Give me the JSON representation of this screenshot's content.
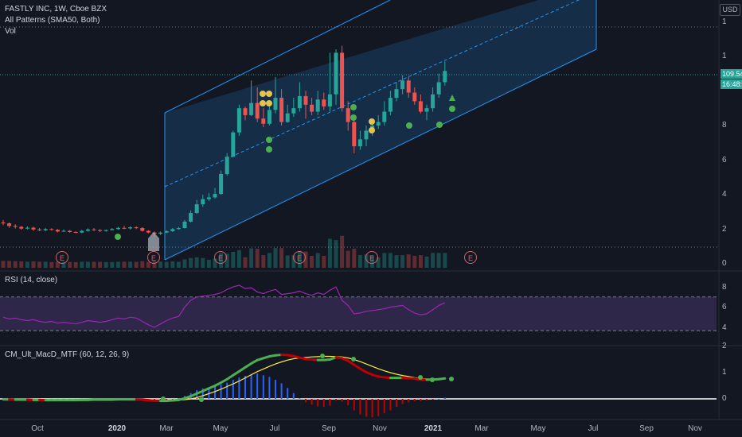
{
  "header": {
    "title": "FASTLY INC, 1W, Cboe BZX",
    "indicator_patterns": "All Patterns (SMA50, Both)",
    "indicator_vol": "Vol"
  },
  "currency": "USD",
  "price_labels": [
    "1",
    "1",
    "8",
    "6",
    "4",
    "2",
    "0"
  ],
  "last_price_tag": "109.54",
  "countdown_tag": "16:48:",
  "rsi": {
    "title": "RSI (14, close)",
    "levels": [
      "8",
      "6",
      "4"
    ]
  },
  "macd": {
    "title": "CM_Ult_MacD_MTF (60, 12, 26, 9)",
    "levels": [
      "2",
      "1",
      "0"
    ]
  },
  "x_ticks": [
    {
      "label": "Oct",
      "bold": false
    },
    {
      "label": "2020",
      "bold": true
    },
    {
      "label": "Mar",
      "bold": false
    },
    {
      "label": "May",
      "bold": false
    },
    {
      "label": "Jul",
      "bold": false
    },
    {
      "label": "Sep",
      "bold": false
    },
    {
      "label": "Nov",
      "bold": false
    },
    {
      "label": "2021",
      "bold": true
    },
    {
      "label": "Mar",
      "bold": false
    },
    {
      "label": "May",
      "bold": false
    },
    {
      "label": "Jul",
      "bold": false
    },
    {
      "label": "Sep",
      "bold": false
    },
    {
      "label": "Nov",
      "bold": false
    }
  ],
  "earnings_marker": "E",
  "colors": {
    "background": "#131722",
    "up": "#26a69a",
    "down": "#ef5350",
    "channel": "#2196f3",
    "rsi_line": "#9c27b0",
    "macd_up": "#4caf50",
    "macd_down": "#c00000",
    "signal": "#ffeb3b",
    "pattern_yellow": "#e5c350",
    "pattern_green": "#4caf50"
  },
  "chart_data": {
    "type": "candlestick",
    "title": "FASTLY INC, 1W, Cboe BZX",
    "series_price": [
      [
        22,
        21.5,
        23.5,
        20.5
      ],
      [
        21.5,
        20,
        22,
        19
      ],
      [
        20,
        19.5,
        21,
        18.5
      ],
      [
        19.5,
        18.5,
        20,
        17.8
      ],
      [
        18.5,
        19,
        19.8,
        18
      ],
      [
        19,
        18,
        19.5,
        17.2
      ],
      [
        18,
        17.5,
        18.8,
        17
      ],
      [
        17.5,
        18.2,
        18.8,
        17
      ],
      [
        18.2,
        17.8,
        18.7,
        17.3
      ],
      [
        17.8,
        16.8,
        18.2,
        16.3
      ],
      [
        16.8,
        17.2,
        18,
        16.5
      ],
      [
        17.2,
        16.5,
        17.6,
        16.1
      ],
      [
        16.5,
        16.2,
        17,
        15.8
      ],
      [
        16.2,
        17.2,
        17.8,
        15.9
      ],
      [
        17.2,
        18,
        18.6,
        16.8
      ],
      [
        18,
        17.6,
        18.8,
        17.1
      ],
      [
        17.6,
        17.1,
        18.2,
        16.5
      ],
      [
        17.1,
        17.6,
        18,
        16.7
      ],
      [
        17.6,
        18.2,
        18.8,
        17.4
      ],
      [
        18.2,
        18.9,
        19.5,
        17.8
      ],
      [
        18.9,
        18.6,
        20,
        18.2
      ],
      [
        18.6,
        19.2,
        19.8,
        18
      ],
      [
        19.2,
        18.8,
        19.8,
        18.2
      ],
      [
        18.8,
        17.2,
        19.3,
        16.8
      ],
      [
        17.2,
        16.2,
        17.5,
        15.8
      ],
      [
        16.2,
        15.5,
        16.8,
        13.9
      ],
      [
        15.5,
        16.2,
        16.8,
        14.8
      ],
      [
        16.2,
        17,
        17.5,
        15.8
      ],
      [
        17,
        18.2,
        18.8,
        16.5
      ],
      [
        18.2,
        18.8,
        19.5,
        17.8
      ],
      [
        18.8,
        22.5,
        23.5,
        18.5
      ],
      [
        22.5,
        27.5,
        29,
        22
      ],
      [
        27.5,
        32.5,
        35,
        27
      ],
      [
        32.5,
        35.5,
        38,
        31
      ],
      [
        35.5,
        36.5,
        39,
        34.5
      ],
      [
        36.5,
        38.5,
        42,
        35.8
      ],
      [
        38.5,
        50,
        52,
        38
      ],
      [
        50,
        60,
        62,
        49
      ],
      [
        60,
        74,
        75,
        59.5
      ],
      [
        74,
        88,
        90,
        72
      ],
      [
        88,
        84,
        89,
        81
      ],
      [
        84,
        91,
        104,
        83.5
      ],
      [
        91,
        82,
        100,
        80
      ],
      [
        82,
        79,
        88,
        77
      ],
      [
        79,
        87,
        92,
        78
      ],
      [
        87,
        94,
        106,
        85
      ],
      [
        94,
        80,
        99,
        78
      ],
      [
        80,
        85,
        90,
        79.5
      ],
      [
        85,
        88,
        94,
        83
      ],
      [
        88,
        95,
        103,
        86
      ],
      [
        95,
        90,
        98,
        82
      ],
      [
        90,
        86,
        94,
        84
      ],
      [
        86,
        93,
        98,
        84
      ],
      [
        93,
        89,
        97,
        87
      ],
      [
        89,
        96,
        120,
        86
      ],
      [
        96,
        120,
        122,
        90
      ],
      [
        120,
        88,
        124,
        86
      ],
      [
        88,
        80,
        92,
        75
      ],
      [
        80,
        66,
        82,
        62
      ],
      [
        66,
        70,
        75,
        64
      ],
      [
        70,
        75,
        78,
        66
      ],
      [
        75,
        78,
        82,
        72
      ],
      [
        78,
        80,
        84,
        76
      ],
      [
        80,
        86,
        92,
        78
      ],
      [
        86,
        94,
        98,
        84
      ],
      [
        94,
        99,
        103,
        92
      ],
      [
        99,
        104,
        107,
        96
      ],
      [
        104,
        97,
        106,
        94
      ],
      [
        97,
        92,
        100,
        90
      ],
      [
        92,
        86,
        96,
        85
      ],
      [
        86,
        88,
        90,
        81
      ],
      [
        88,
        96,
        100,
        86
      ],
      [
        96,
        103,
        108,
        94
      ],
      [
        103,
        109.5,
        115,
        101
      ]
    ],
    "series_rsi": [
      46,
      44,
      45,
      43,
      42,
      43,
      41,
      40,
      41,
      39,
      40,
      39,
      38,
      40,
      42,
      41,
      40,
      41,
      43,
      45,
      44,
      46,
      45,
      41,
      37,
      34,
      38,
      42,
      45,
      47,
      58,
      66,
      70,
      71,
      72,
      73,
      75,
      79,
      82,
      84,
      80,
      81,
      76,
      74,
      77,
      79,
      73,
      74,
      75,
      77,
      74,
      72,
      75,
      73,
      78,
      82,
      66,
      60,
      50,
      51,
      53,
      54,
      55,
      56,
      58,
      59,
      60,
      55,
      51,
      49,
      50,
      55,
      60,
      63
    ],
    "rsi_levels": [
      70,
      30
    ],
    "series_macd": [
      -0.02,
      -0.02,
      -0.03,
      -0.03,
      -0.03,
      -0.04,
      -0.04,
      -0.05,
      -0.05,
      -0.05,
      -0.05,
      -0.05,
      -0.05,
      -0.04,
      -0.04,
      -0.03,
      -0.03,
      -0.03,
      -0.03,
      -0.02,
      -0.02,
      -0.02,
      -0.02,
      -0.03,
      -0.05,
      -0.07,
      -0.08,
      -0.08,
      -0.06,
      -0.04,
      0.02,
      0.1,
      0.2,
      0.3,
      0.4,
      0.5,
      0.62,
      0.75,
      0.9,
      1.05,
      1.2,
      1.35,
      1.48,
      1.55,
      1.62,
      1.66,
      1.68,
      1.67,
      1.63,
      1.57,
      1.52,
      1.5,
      1.48,
      1.48,
      1.5,
      1.58,
      1.55,
      1.45,
      1.3,
      1.15,
      1.02,
      0.92,
      0.85,
      0.82,
      0.8,
      0.8,
      0.8,
      0.79,
      0.77,
      0.74,
      0.73,
      0.74,
      0.75,
      0.78
    ],
    "series_signal": [
      -0.02,
      -0.02,
      -0.02,
      -0.02,
      -0.03,
      -0.03,
      -0.03,
      -0.04,
      -0.04,
      -0.04,
      -0.04,
      -0.04,
      -0.04,
      -0.04,
      -0.04,
      -0.04,
      -0.03,
      -0.03,
      -0.03,
      -0.03,
      -0.03,
      -0.02,
      -0.02,
      -0.02,
      -0.03,
      -0.04,
      -0.05,
      -0.05,
      -0.05,
      -0.05,
      -0.03,
      0.0,
      0.05,
      0.12,
      0.2,
      0.28,
      0.37,
      0.47,
      0.57,
      0.68,
      0.8,
      0.92,
      1.04,
      1.14,
      1.24,
      1.33,
      1.41,
      1.48,
      1.53,
      1.56,
      1.58,
      1.6,
      1.61,
      1.62,
      1.62,
      1.61,
      1.6,
      1.56,
      1.5,
      1.42,
      1.33,
      1.24,
      1.15,
      1.07,
      1.0,
      0.94,
      0.89,
      0.85,
      0.81,
      0.78,
      0.76,
      0.75,
      0.75,
      0.76
    ]
  }
}
